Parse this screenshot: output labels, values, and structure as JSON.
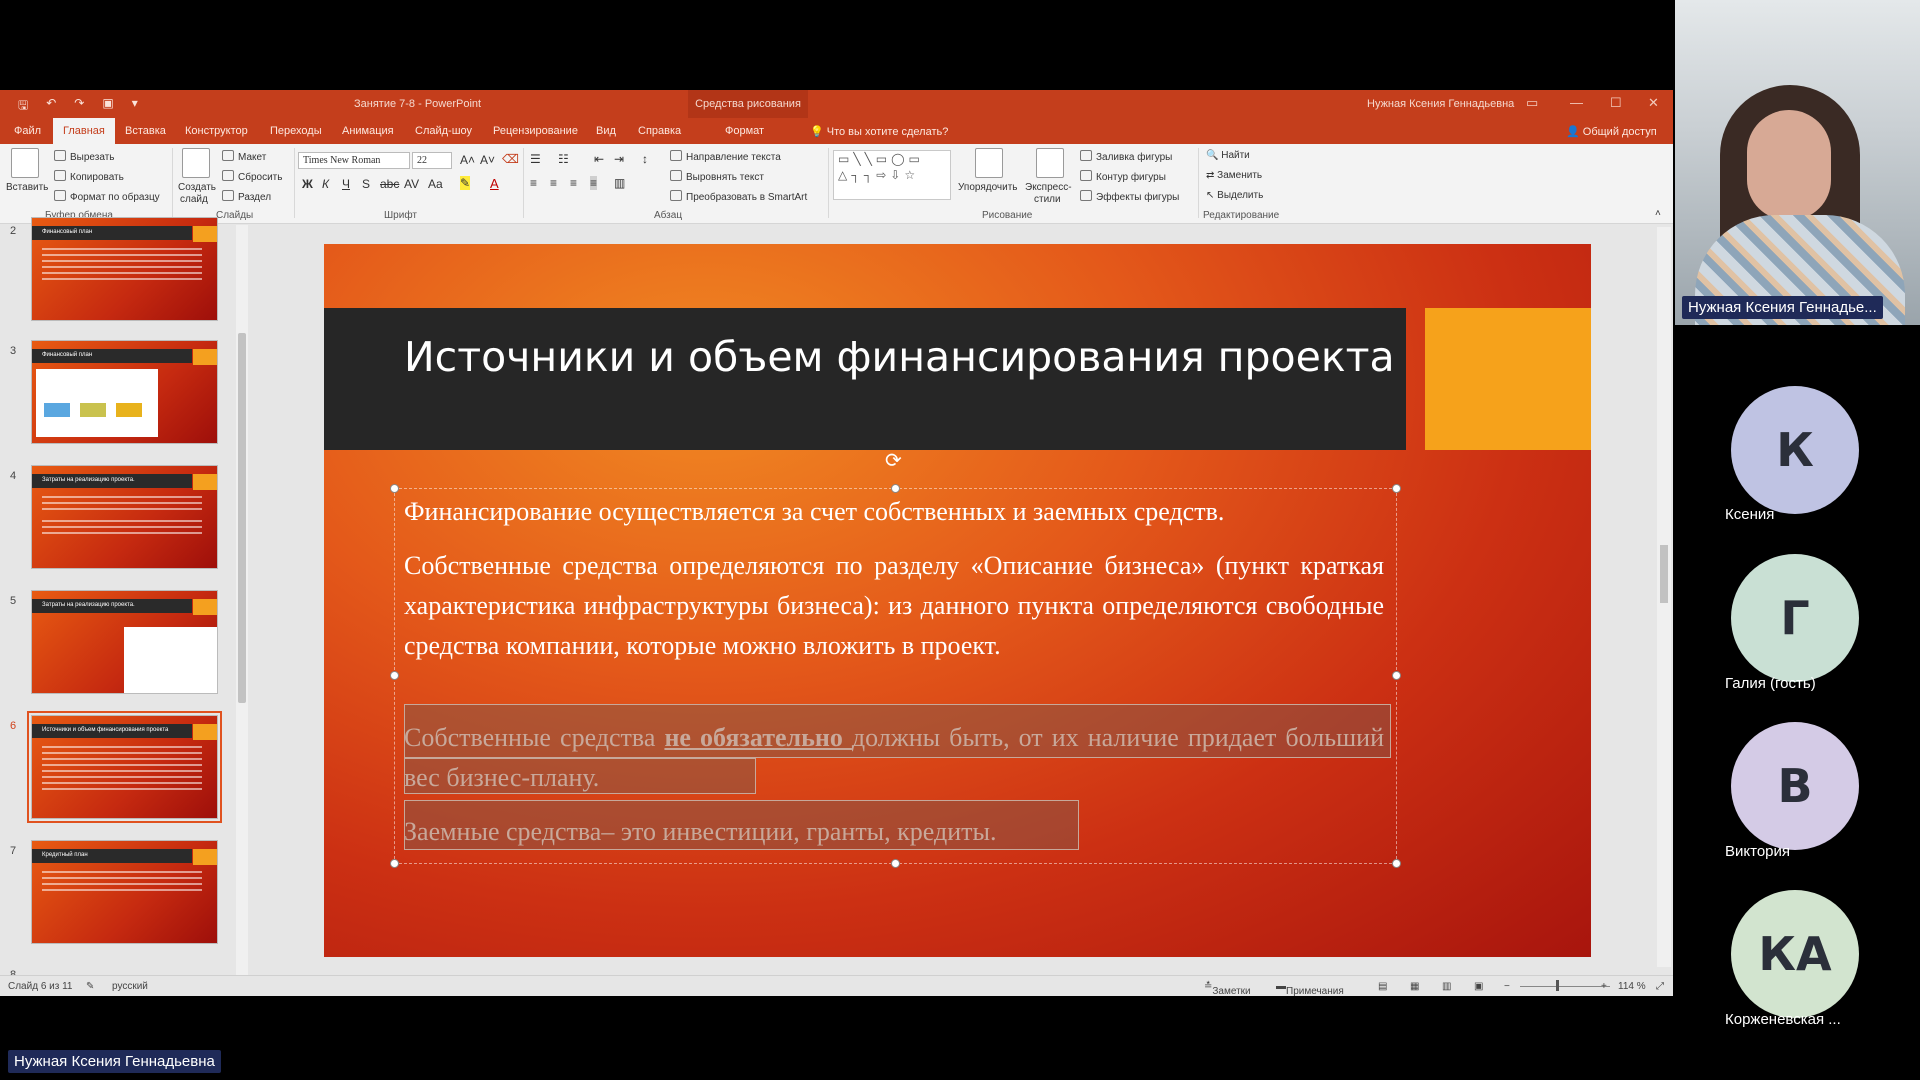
{
  "window": {
    "title": "Занятие 7-8  -  PowerPoint",
    "context_tab": "Средства рисования",
    "user": "Нужная Ксения Геннадьевна"
  },
  "tabs": [
    "Файл",
    "Главная",
    "Вставка",
    "Конструктор",
    "Переходы",
    "Анимация",
    "Слайд-шоу",
    "Рецензирование",
    "Вид",
    "Справка",
    "Формат"
  ],
  "tell_me": "Что вы хотите сделать?",
  "share": "Общий доступ",
  "ribbon": {
    "paste": "Вставить",
    "cut": "Вырезать",
    "copy": "Копировать",
    "format_painter": "Формат по образцу",
    "clipboard_group": "Буфер обмена",
    "new_slide_1": "Создать",
    "new_slide_2": "слайд",
    "layout": "Макет",
    "reset": "Сбросить",
    "section": "Раздел",
    "slides_group": "Слайды",
    "font_name": "Times New Roman",
    "font_size": "22",
    "font_group": "Шрифт",
    "text_direction": "Направление текста",
    "align_text": "Выровнять текст",
    "smartart": "Преобразовать в SmartArt",
    "paragraph_group": "Абзац",
    "arrange": "Упорядочить",
    "quick_styles_1": "Экспресс-",
    "quick_styles_2": "стили",
    "shape_fill": "Заливка фигуры",
    "shape_outline": "Контур фигуры",
    "shape_effects": "Эффекты фигуры",
    "drawing_group": "Рисование",
    "find": "Найти",
    "replace": "Заменить",
    "select": "Выделить",
    "editing_group": "Редактирование"
  },
  "thumbnails": [
    {
      "num": "2",
      "title": "Финансовый план"
    },
    {
      "num": "3",
      "title": "Финансовый план"
    },
    {
      "num": "4",
      "title": "Затраты на реализацию проекта."
    },
    {
      "num": "5",
      "title": "Затраты на реализацию проекта."
    },
    {
      "num": "6",
      "title": "Источники и объем финансирования проекта"
    },
    {
      "num": "7",
      "title": "Кредитный план"
    },
    {
      "num": "8",
      "title": ""
    }
  ],
  "slide": {
    "title": "Источники и объем финансирования проекта",
    "p1": "Финансирование осуществляется за счет собственных и заемных средств.",
    "p2": "Собственные средства определяются по разделу «Описание бизнеса» (пункт краткая характеристика инфраструктуры бизнеса): из данного пункта определяются свободные средства компании, которые можно вложить в проект.",
    "p3_a": "Собственные средства ",
    "p3_b": "не обязательно ",
    "p3_c": "должны быть, от их наличие придает больший вес бизнес-плану.",
    "p4": "Заемные средства– это инвестиции, гранты, кредиты."
  },
  "status": {
    "slide_of": "Слайд 6 из 11",
    "language": "русский",
    "notes": "Заметки",
    "comments": "Примечания",
    "zoom": "114 %"
  },
  "call": {
    "presenter_name": "Нужная Ксения Геннадье...",
    "bottom_name": "Нужная Ксения Геннадьевна",
    "participants": [
      {
        "initial": "К",
        "name": "Ксения",
        "color": "#bfc3e3"
      },
      {
        "initial": "Г",
        "name": "Галия (гость)",
        "color": "#c9e0d4"
      },
      {
        "initial": "В",
        "name": "Виктория",
        "color": "#d4cbe6"
      },
      {
        "initial": "КА",
        "name": "Корженевская ...",
        "color": "#d2e4cf"
      }
    ]
  }
}
